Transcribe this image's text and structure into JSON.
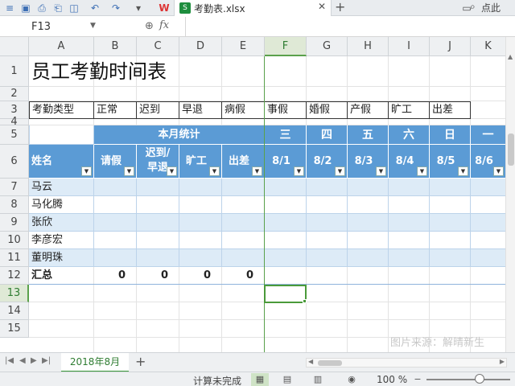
{
  "titlebar": {
    "file_tab": "考勤表.xlsx",
    "right_text": "点此"
  },
  "formula": {
    "cell_ref": "F13",
    "fx": "fx",
    "value": ""
  },
  "columns": [
    "A",
    "B",
    "C",
    "D",
    "E",
    "F",
    "G",
    "H",
    "I",
    "J",
    "K"
  ],
  "rows": [
    "1",
    "2",
    "3",
    "4",
    "5",
    "6",
    "7",
    "8",
    "9",
    "10",
    "11",
    "12",
    "13",
    "14",
    "15"
  ],
  "sheet": {
    "title": "员工考勤时间表",
    "attendance_types": [
      "考勤类型",
      "正常",
      "迟到",
      "早退",
      "病假",
      "事假",
      "婚假",
      "产假",
      "旷工",
      "出差"
    ],
    "monthly_stats_label": "本月统计",
    "weekdays": [
      "三",
      "四",
      "五",
      "六",
      "日",
      "一"
    ],
    "header": [
      "姓名",
      "请假",
      "迟到/早退",
      "旷工",
      "出差",
      "8/1",
      "8/2",
      "8/3",
      "8/4",
      "8/5",
      "8/6"
    ],
    "employees": [
      "马云",
      "马化腾",
      "张欣",
      "李彦宏",
      "董明珠"
    ],
    "summary_label": "汇总",
    "summary_values": [
      "0",
      "0",
      "0",
      "0"
    ]
  },
  "watermark": "图片来源：解晴新生",
  "sheet_tabs": [
    "2018年8月"
  ],
  "status": {
    "text": "计算未完成",
    "zoom": "100 %"
  }
}
